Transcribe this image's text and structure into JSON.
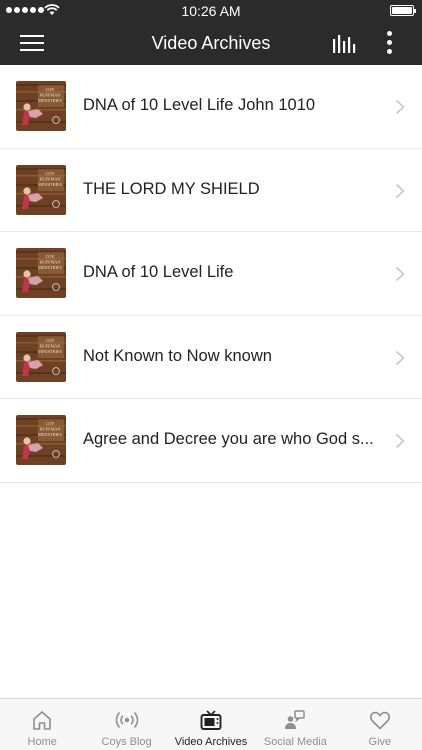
{
  "status_bar": {
    "time": "10:26 AM"
  },
  "nav": {
    "title": "Video Archives"
  },
  "items": [
    {
      "title": "DNA of 10 Level Life John 1010",
      "thumb_label": "COY HUFFMAN MINISTRIES"
    },
    {
      "title": "THE LORD MY SHIELD",
      "thumb_label": "COY HUFFMAN MINISTRIES"
    },
    {
      "title": "DNA of 10 Level Life",
      "thumb_label": "COY HUFFMAN MINISTRIES"
    },
    {
      "title": "Not Known to Now known",
      "thumb_label": "COY HUFFMAN MINISTRIES"
    },
    {
      "title": "Agree and Decree you are who God s...",
      "thumb_label": "COY HUFFMAN MINISTRIES"
    }
  ],
  "tabs": [
    {
      "label": "Home",
      "icon": "home-icon"
    },
    {
      "label": "Coys Blog",
      "icon": "broadcast-icon"
    },
    {
      "label": "Video Archives",
      "icon": "tv-icon",
      "active": true
    },
    {
      "label": "Social Media",
      "icon": "social-media-icon"
    },
    {
      "label": "Give",
      "icon": "heart-icon"
    }
  ],
  "colors": {
    "nav_bg": "#2b2b2b",
    "tab_active": "#222222",
    "tab_inactive": "#8e8e93",
    "thumb_wood": "#7a4a2a"
  }
}
